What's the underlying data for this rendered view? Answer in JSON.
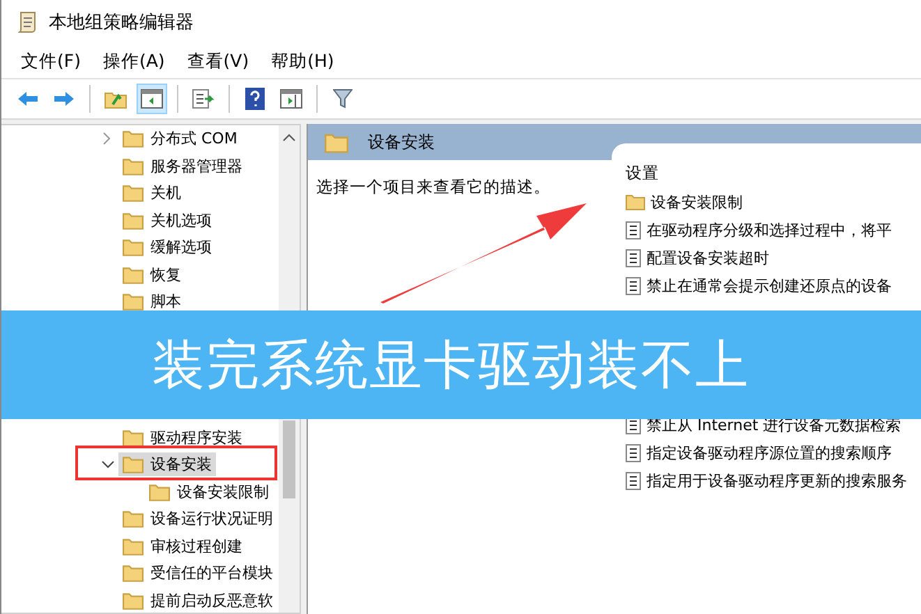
{
  "window": {
    "title": "本地组策略编辑器"
  },
  "menu": [
    {
      "label": "文件(F)"
    },
    {
      "label": "操作(A)"
    },
    {
      "label": "查看(V)"
    },
    {
      "label": "帮助(H)"
    }
  ],
  "toolbar": [
    [
      {
        "kind": "back",
        "pressed": false
      },
      {
        "kind": "forward",
        "pressed": false
      }
    ],
    [
      {
        "kind": "up",
        "pressed": false
      },
      {
        "kind": "tree",
        "pressed": true
      }
    ],
    [
      {
        "kind": "export",
        "pressed": false
      }
    ],
    [
      {
        "kind": "help",
        "pressed": false
      },
      {
        "kind": "pane",
        "pressed": false
      }
    ],
    [
      {
        "kind": "filter",
        "pressed": false
      }
    ]
  ],
  "tree": {
    "items": [
      {
        "label": "分布式 COM",
        "expanded": false,
        "selected": false
      },
      {
        "label": "服务器管理器",
        "selected": false
      },
      {
        "label": "关机",
        "selected": false
      },
      {
        "label": "关机选项",
        "selected": false
      },
      {
        "label": "缓解选项",
        "selected": false
      },
      {
        "label": "恢复",
        "selected": false
      },
      {
        "label": "脚本",
        "selected": false
      },
      {
        "label": "驱动程序安装",
        "selected": false
      },
      {
        "label": "设备安装",
        "expanded": true,
        "selected": true,
        "children": [
          {
            "label": "设备安装限制",
            "selected": false
          }
        ]
      },
      {
        "label": "设备运行状况证明",
        "selected": false
      },
      {
        "label": "审核过程创建",
        "selected": false
      },
      {
        "label": "受信任的平台模块",
        "selected": false
      },
      {
        "label": "提前启动反恶意软",
        "selected": false
      }
    ]
  },
  "detail": {
    "heading": "设备安装",
    "description": "选择一个项目来查看它的描述。",
    "column_header": "设置",
    "items": [
      {
        "kind": "folder",
        "label": "设备安装限制"
      },
      {
        "kind": "setting",
        "label": "在驱动程序分级和选择过程中，将平"
      },
      {
        "kind": "setting",
        "label": "配置设备安装超时"
      },
      {
        "kind": "setting",
        "label": "禁止在通常会提示创建还原点的设备"
      },
      {
        "kind": "setting",
        "label": "禁止从 Internet 进行设备元数据检索"
      },
      {
        "kind": "setting",
        "label": "指定设备驱动程序源位置的搜索顺序"
      },
      {
        "kind": "setting",
        "label": "指定用于设备驱动程序更新的搜索服务"
      }
    ]
  },
  "banner": {
    "text": "装完系统显卡驱动装不上"
  }
}
